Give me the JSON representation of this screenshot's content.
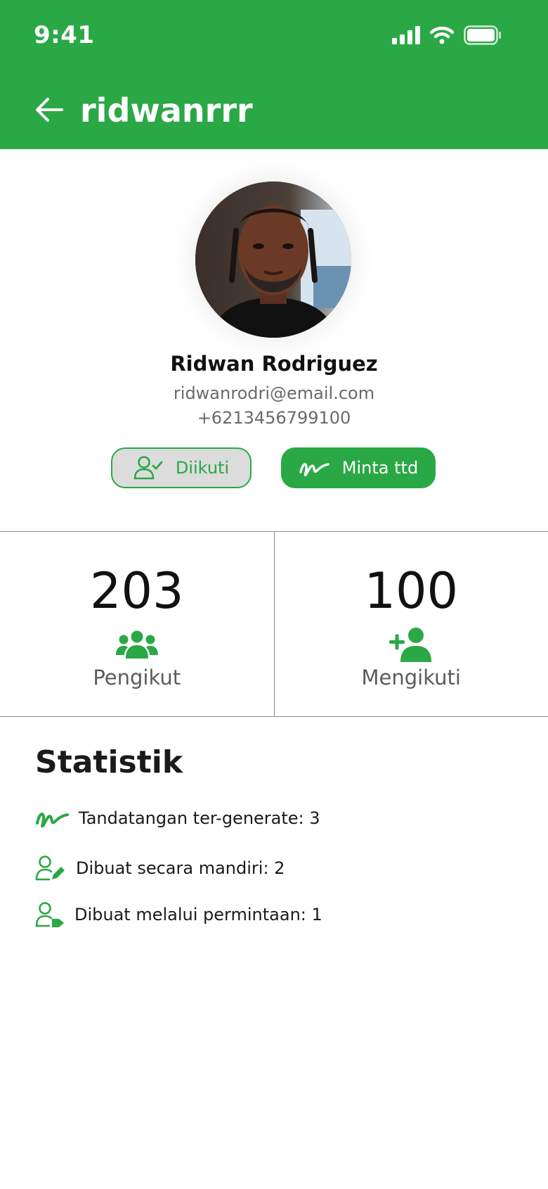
{
  "status_bar": {
    "time": "9:41",
    "icons": [
      "signal-icon",
      "wifi-icon",
      "battery-icon"
    ]
  },
  "header": {
    "title": "ridwanrrr",
    "back_icon": "arrow-left-icon",
    "background": "#2aa845"
  },
  "profile": {
    "name": "Ridwan Rodriguez",
    "email": "ridwanrodri@email.com",
    "phone": "+6213456799100",
    "follow_button": "Diikuti",
    "sign_request_button": "Minta ttd"
  },
  "counts": {
    "followers": {
      "value": "203",
      "label": "Pengikut",
      "icon": "users-group-icon"
    },
    "following": {
      "value": "100",
      "label": "Mengikuti",
      "icon": "user-plus-icon"
    }
  },
  "statistics": {
    "title": "Statistik",
    "items": [
      {
        "label": "Tandatangan ter-generate: 3",
        "icon": "signature-icon"
      },
      {
        "label": "Dibuat secara mandiri: 2",
        "icon": "user-edit-icon"
      },
      {
        "label": "Dibuat melalui permintaan: 1",
        "icon": "user-tag-icon"
      }
    ]
  },
  "colors": {
    "accent": "#2aa845",
    "muted_text": "#6a6a6a",
    "follow_button_bg": "#dcdcdc"
  }
}
